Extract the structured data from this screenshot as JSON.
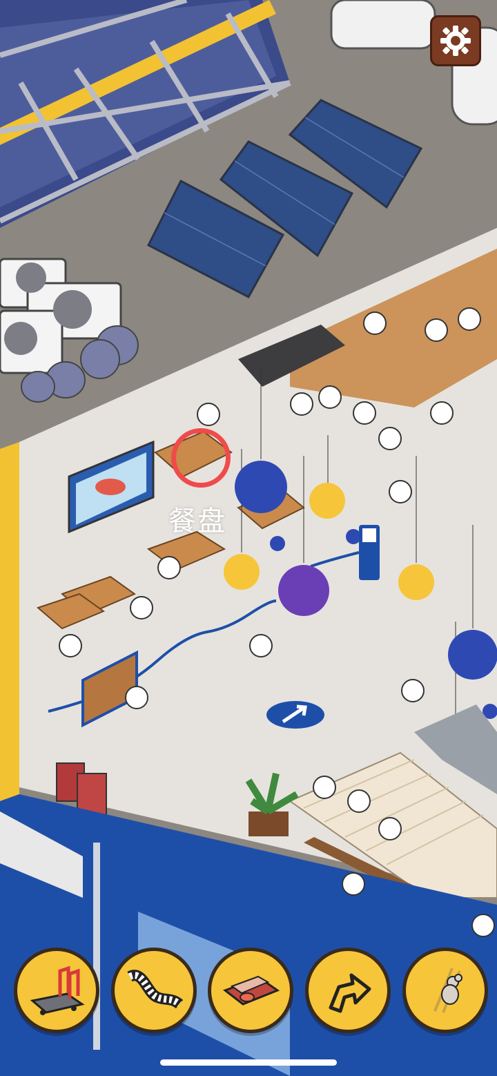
{
  "hint": {
    "label": "餐盘"
  },
  "settings": {
    "icon": "gear-icon"
  },
  "toolbar": {
    "items": [
      {
        "id": "cart",
        "icon": "hand-truck-icon"
      },
      {
        "id": "ribbon",
        "icon": "film-strip-icon"
      },
      {
        "id": "tray",
        "icon": "food-tray-icon"
      },
      {
        "id": "arrow",
        "icon": "curved-arrow-icon"
      },
      {
        "id": "mouse",
        "icon": "mouse-ladder-icon"
      }
    ]
  },
  "colors": {
    "accent_yellow": "#f6c53a",
    "settings_brown": "#7a3b22",
    "target_red": "#f04b4b",
    "floor": "#e6e3de",
    "roof": "#8c8781",
    "wall_blue": "#1e4fa8"
  }
}
